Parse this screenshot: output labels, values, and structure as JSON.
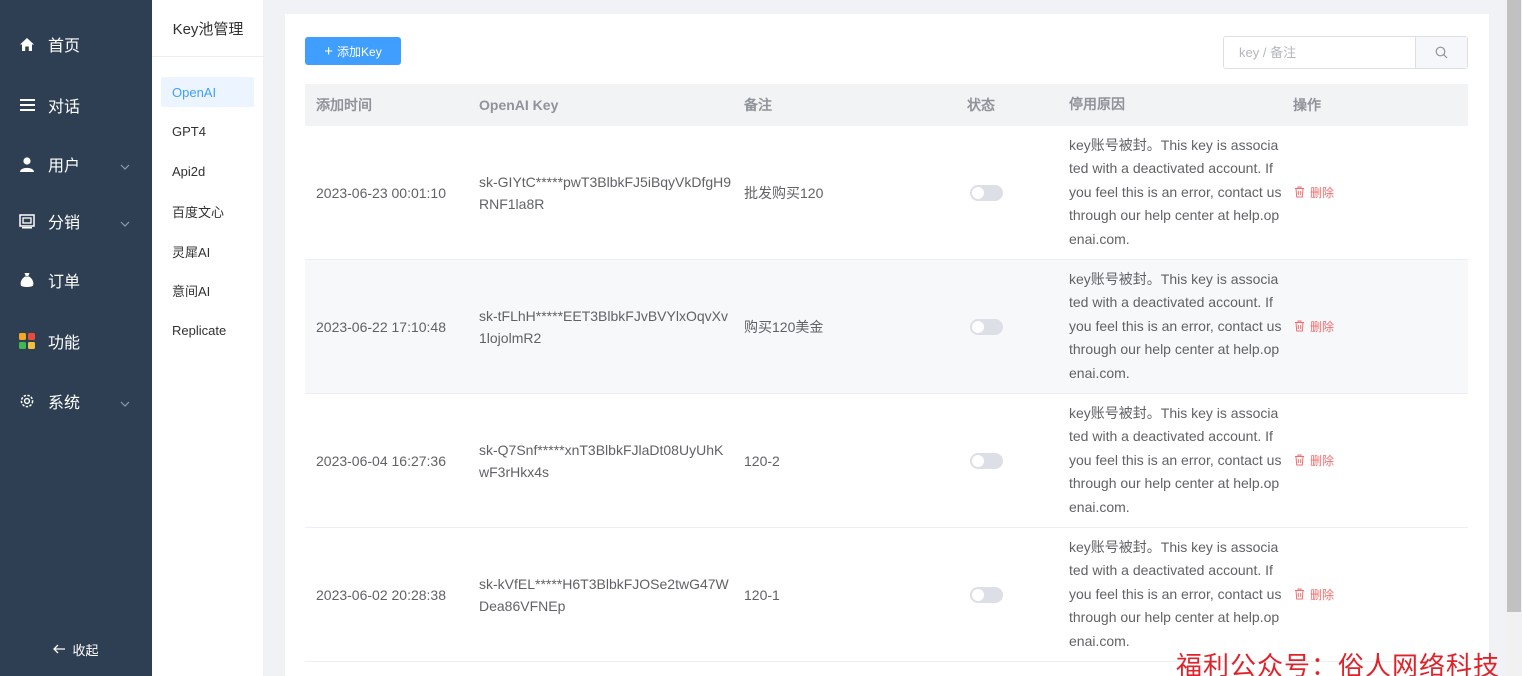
{
  "sidebar": {
    "items": [
      {
        "label": "首页",
        "icon": "home-icon"
      },
      {
        "label": "对话",
        "icon": "menu-lines-icon"
      },
      {
        "label": "用户",
        "icon": "user-icon"
      },
      {
        "label": "分销",
        "icon": "distribution-icon"
      },
      {
        "label": "订单",
        "icon": "money-bag-icon"
      },
      {
        "label": "功能",
        "icon": "grid-icon"
      },
      {
        "label": "系统",
        "icon": "gear-icon"
      }
    ],
    "collapse_label": "收起"
  },
  "submenu": {
    "title": "Key池管理",
    "items": [
      "OpenAI",
      "GPT4",
      "Api2d",
      "百度文心",
      "灵犀AI",
      "意间AI",
      "Replicate"
    ],
    "active": "OpenAI"
  },
  "toolbar": {
    "add_label": "添加Key",
    "search_placeholder": "key / 备注"
  },
  "table": {
    "headers": [
      "添加时间",
      "OpenAI Key",
      "备注",
      "状态",
      "停用原因",
      "操作"
    ],
    "delete_label": "删除",
    "rows": [
      {
        "time": "2023-06-23 00:01:10",
        "key": "sk-GIYtC*****pwT3BlbkFJ5iBqyVkDfgH9RNF1la8R",
        "note": "批发购买120",
        "enabled": false,
        "reason": "key账号被封。This key is associated with a deactivated account. If you feel this is an error, contact us through our help center at help.openai.com."
      },
      {
        "time": "2023-06-22 17:10:48",
        "key": "sk-tFLhH*****EET3BlbkFJvBVYlxOqvXv1lojolmR2",
        "note": "购买120美金",
        "enabled": false,
        "reason": "key账号被封。This key is associated with a deactivated account. If you feel this is an error, contact us through our help center at help.openai.com."
      },
      {
        "time": "2023-06-04 16:27:36",
        "key": "sk-Q7Snf*****xnT3BlbkFJlaDt08UyUhKwF3rHkx4s",
        "note": "120-2",
        "enabled": false,
        "reason": "key账号被封。This key is associated with a deactivated account. If you feel this is an error, contact us through our help center at help.openai.com."
      },
      {
        "time": "2023-06-02 20:28:38",
        "key": "sk-kVfEL*****H6T3BlbkFJOSe2twG47WDea86VFNEp",
        "note": "120-1",
        "enabled": false,
        "reason": "key账号被封。This key is associated with a deactivated account. If you feel this is an error, contact us through our help center at help.openai.com."
      }
    ]
  },
  "watermark": "福利公众号：俗人网络科技",
  "colors": {
    "sidebar_bg": "#2f3f53",
    "primary": "#409eff",
    "danger": "#f56c6c",
    "watermark": "#e0232a"
  }
}
